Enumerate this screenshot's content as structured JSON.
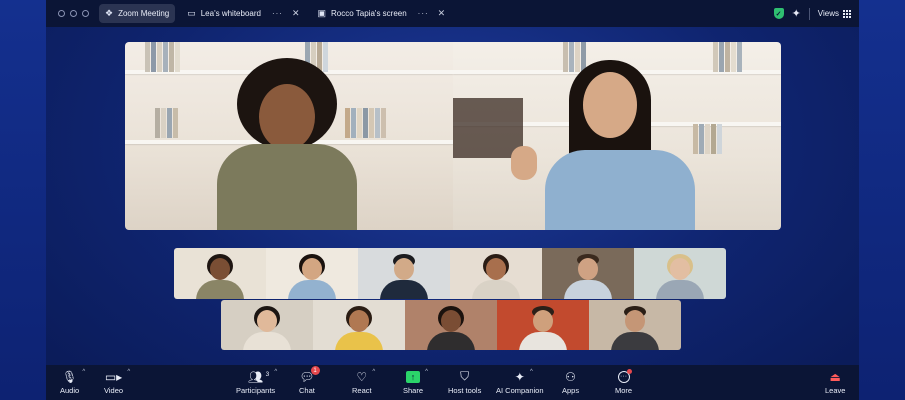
{
  "titlebar": {
    "tabs": [
      {
        "label": "Zoom Meeting",
        "icon": "zoom-paw-icon"
      },
      {
        "label": "Lea's whiteboard",
        "icon": "whiteboard-icon"
      },
      {
        "label": "Rocco Tapia's screen",
        "icon": "screen-share-icon"
      }
    ],
    "views_label": "Views"
  },
  "toolbar": {
    "audio": "Audio",
    "video": "Video",
    "participants": "Participants",
    "participants_count": "3",
    "chat": "Chat",
    "chat_badge": "1",
    "react": "React",
    "share": "Share",
    "host_tools": "Host tools",
    "ai_companion": "AI Companion",
    "apps": "Apps",
    "more": "More",
    "leave": "Leave"
  },
  "colors": {
    "background": "#0f246f",
    "bar": "#0b1536",
    "share_green": "#2bd46a",
    "alert_red": "#e5484d",
    "shield_green": "#2fbf71"
  }
}
